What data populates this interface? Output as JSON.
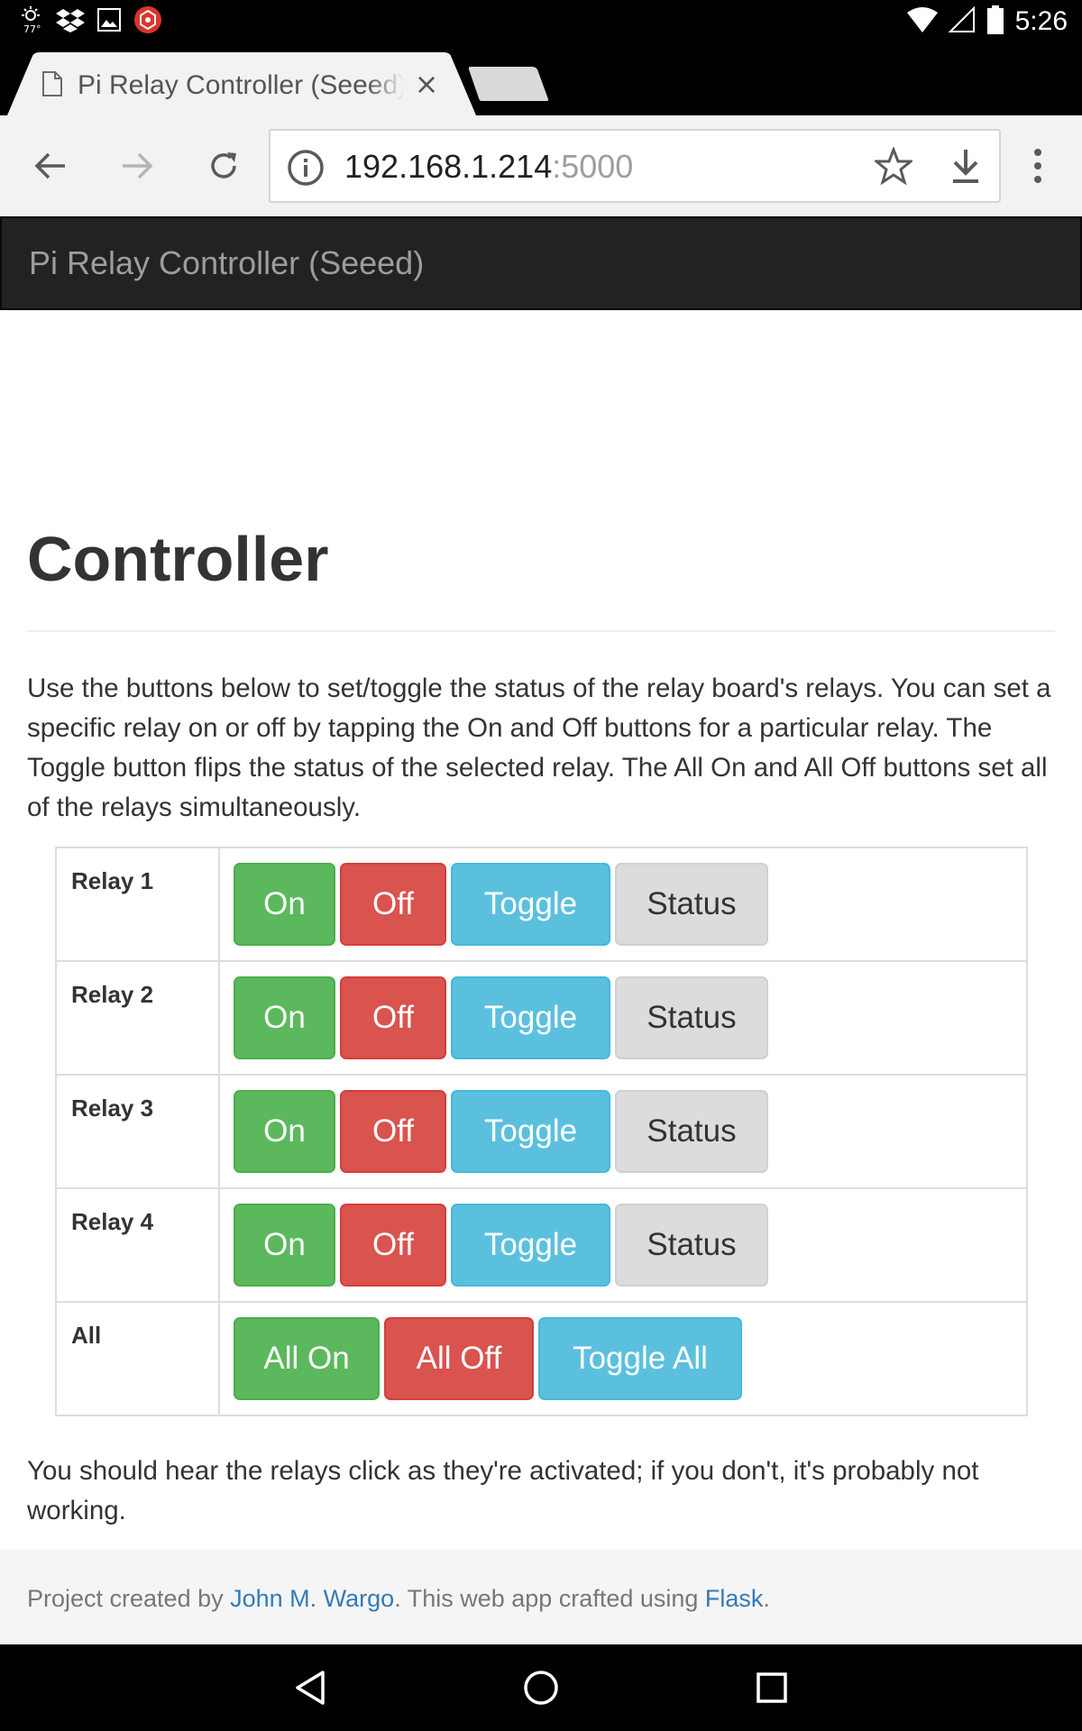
{
  "status_bar": {
    "time": "5:26",
    "icons_left": [
      "weather-icon",
      "dropbox-icon",
      "gallery-icon",
      "app-hexagon-icon"
    ],
    "icons_right": [
      "wifi-icon",
      "signal-icon",
      "battery-icon"
    ]
  },
  "browser": {
    "tab": {
      "title": "Pi Relay Controller (Seeed)",
      "close_glyph": "×"
    },
    "url_host": "192.168.1.214",
    "url_port": ":5000",
    "toolbar_icons": [
      "back-icon",
      "forward-icon",
      "reload-icon",
      "info-icon",
      "star-icon",
      "download-icon",
      "menu-icon"
    ]
  },
  "page": {
    "brand": "Pi Relay Controller (Seeed)",
    "title": "Controller",
    "intro": "Use the buttons below to set/toggle the status of the relay board's relays. You can set a specific relay on or off by tapping the On and Off buttons for a particular relay. The Toggle button flips the status of the selected relay. The All On and All Off buttons set all of the relays simultaneously.",
    "relays": [
      {
        "label": "Relay 1",
        "on": "On",
        "off": "Off",
        "toggle": "Toggle",
        "status": "Status"
      },
      {
        "label": "Relay 2",
        "on": "On",
        "off": "Off",
        "toggle": "Toggle",
        "status": "Status"
      },
      {
        "label": "Relay 3",
        "on": "On",
        "off": "Off",
        "toggle": "Toggle",
        "status": "Status"
      },
      {
        "label": "Relay 4",
        "on": "On",
        "off": "Off",
        "toggle": "Toggle",
        "status": "Status"
      }
    ],
    "all_row": {
      "label": "All",
      "all_on": "All On",
      "all_off": "All Off",
      "toggle_all": "Toggle All"
    },
    "outro": "You should hear the relays click as they're activated; if you don't, it's probably not working.",
    "footer": {
      "prefix": "Project created by ",
      "author_link": "John M. Wargo",
      "middle": ". This web app crafted using ",
      "flask_link": "Flask",
      "suffix": "."
    }
  },
  "colors": {
    "on": "#5cb85c",
    "off": "#d9534f",
    "toggle": "#5bc0de",
    "status": "#dcdcdc",
    "navbar": "#222222",
    "link": "#337ab7"
  },
  "system_nav": [
    "back-triangle-icon",
    "home-circle-icon",
    "recents-square-icon"
  ]
}
